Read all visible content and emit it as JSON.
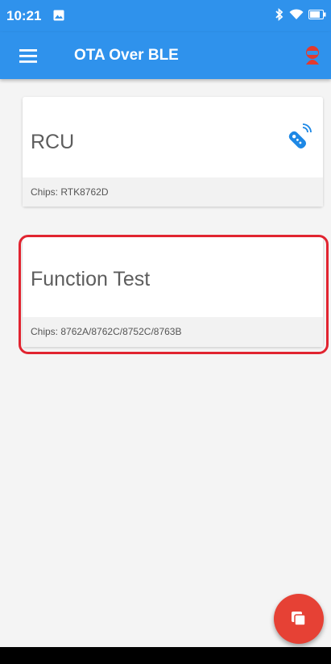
{
  "status_bar": {
    "time": "10:21"
  },
  "app_bar": {
    "title": "OTA Over BLE"
  },
  "cards": [
    {
      "title": "RCU",
      "chips": "Chips: RTK8762D"
    },
    {
      "title": "Function Test",
      "chips": "Chips: 8762A/8762C/8752C/8763B"
    }
  ],
  "colors": {
    "primary": "#2f92ec",
    "accent": "#e64135",
    "highlight": "#e12430"
  },
  "icons": {
    "menu": "hamburger-menu-icon",
    "profile": "profile-icon",
    "remote": "remote-control-icon",
    "fab": "copy-icon"
  }
}
